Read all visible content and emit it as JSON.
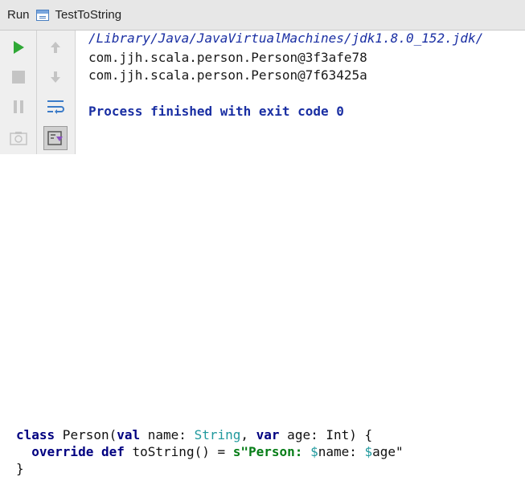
{
  "run_window": {
    "label": "Run",
    "tab_name": "TestToString"
  },
  "toolbar_icons": {
    "left": [
      "play-icon",
      "stop-icon",
      "pause-icon",
      "camera-icon"
    ],
    "right": [
      "up-arrow-icon",
      "down-arrow-icon",
      "soft-wrap-icon",
      "scroll-to-end-icon"
    ]
  },
  "console": {
    "command": "/Library/Java/JavaVirtualMachines/jdk1.8.0_152.jdk/",
    "output": [
      "com.jjh.scala.person.Person@3f3afe78",
      "com.jjh.scala.person.Person@7f63425a"
    ],
    "exit_message": "Process finished with exit code 0"
  },
  "code": {
    "line1": {
      "kw_class": "class",
      "t1": " Person(",
      "kw_val": "val",
      "t2": " name: ",
      "type_string": "String",
      "t3": ", ",
      "kw_var": "var",
      "t4": " age: Int) {"
    },
    "line2": {
      "indent": "  ",
      "kw_override": "override",
      "sp1": " ",
      "kw_def": "def",
      "t1": " toString() = ",
      "str_open": "s\"Person: ",
      "dollar1": "$",
      "t_name": "name: ",
      "dollar2": "$",
      "t_age": "age\""
    },
    "line3": "}"
  },
  "colors": {
    "keyword": "#000080",
    "string": "#067d17",
    "type": "#20999d",
    "console_system": "#1a2fa3"
  }
}
